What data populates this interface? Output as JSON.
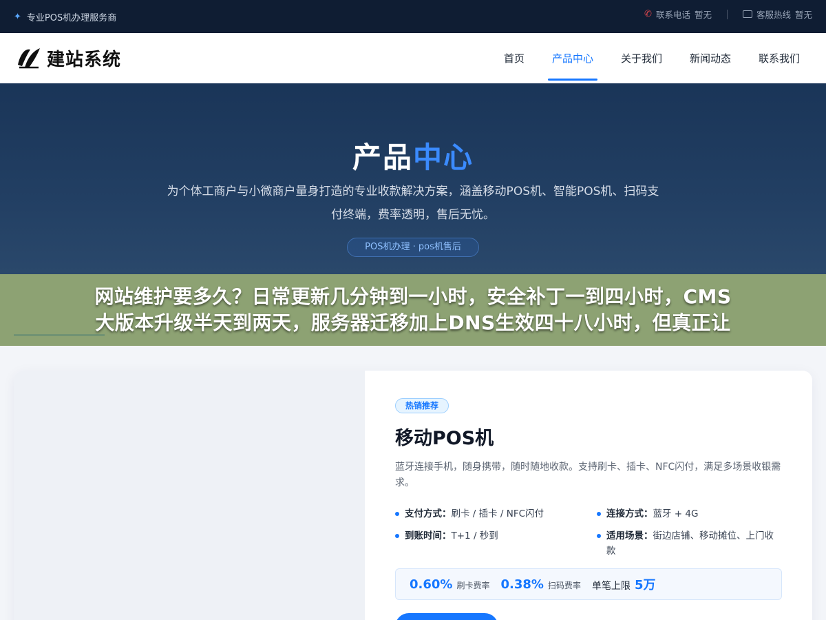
{
  "topbar": {
    "tagline": "专业POS机办理服务商",
    "phone_label": "联系电话",
    "phone_value": "暂无",
    "service_label": "客服热线",
    "service_value": "暂无"
  },
  "header": {
    "logo_text": "建站系统",
    "nav": [
      {
        "label": "首页",
        "active": false
      },
      {
        "label": "产品中心",
        "active": true
      },
      {
        "label": "关于我们",
        "active": false
      },
      {
        "label": "新闻动态",
        "active": false
      },
      {
        "label": "联系我们",
        "active": false
      }
    ]
  },
  "hero": {
    "title_main": "产品",
    "title_accent": "中心",
    "description": "为个体工商户与小微商户量身打造的专业收款解决方案，涵盖移动POS机、智能POS机、扫码支付终端，费率透明，售后无忧。",
    "pill": "POS机办理 · pos机售后"
  },
  "caption": {
    "line1": "网站维护要多久？日常更新几分钟到一小时，安全补丁一到四小时，CMS",
    "line2": "大版本升级半天到两天，服务器迁移加上DNS生效四十八小时，但真正让"
  },
  "product": {
    "badge": "热销推荐",
    "title": "移动POS机",
    "description": "蓝牙连接手机，随身携带，随时随地收款。支持刷卡、插卡、NFC闪付，满足多场景收银需求。",
    "specs": [
      {
        "key": "支付方式：",
        "value": "刷卡 / 插卡 / NFC闪付"
      },
      {
        "key": "连接方式：",
        "value": "蓝牙 + 4G"
      },
      {
        "key": "到账时间：",
        "value": "T+1 / 秒到"
      },
      {
        "key": "适用场景：",
        "value": "街边店铺、移动摊位、上门收款"
      }
    ],
    "rates": {
      "card_rate": "0.60%",
      "card_rate_label": "刷卡费率",
      "scan_rate": "0.38%",
      "scan_rate_label": "扫码费率",
      "limit_label": "单笔上限",
      "limit_value": "5万"
    }
  },
  "colors": {
    "accent": "#1677ff",
    "topbar_bg": "#0f1d33",
    "hero_bg": "#1a3558",
    "caption_bg": "#7e9660"
  }
}
